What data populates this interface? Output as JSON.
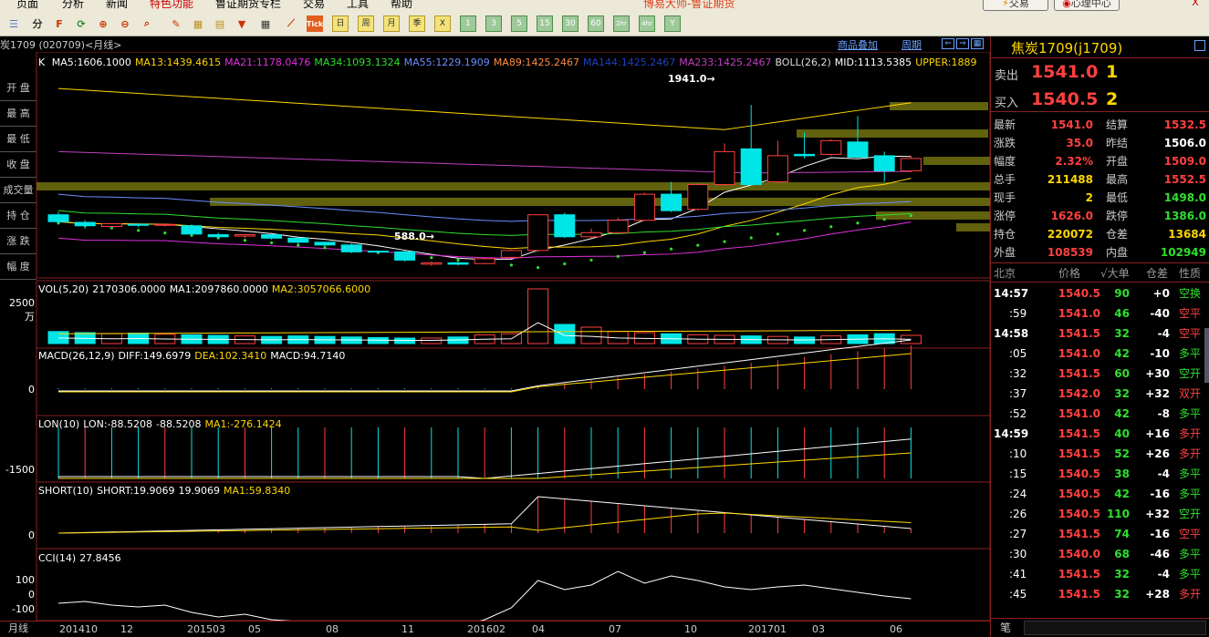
{
  "app": {
    "title": "博易大师-鲁证期货",
    "trade_button": "交易",
    "center_button": "心理中心",
    "close_button": "X"
  },
  "menu": [
    "页面",
    "分析",
    "新闻",
    "特色功能",
    "鲁证期货专栏",
    "交易",
    "工具",
    "帮助"
  ],
  "toolbar": {
    "period_buttons": [
      "日",
      "周",
      "月",
      "季",
      "X",
      "1",
      "3",
      "5",
      "15",
      "30",
      "60",
      "2hr",
      "4hr",
      "Y"
    ],
    "tick_label": "Tick"
  },
  "contract": {
    "header": "炭1709 (020709)<月线>",
    "overlay_link": "商品叠加",
    "period_link": "周期"
  },
  "left_labels": [
    "开 盘",
    "最 高",
    "最 低",
    "收 盘",
    "成交量",
    "持 仓",
    "涨 跌",
    "幅 度"
  ],
  "main_indicator": {
    "prefix": "K",
    "items": [
      {
        "text": "MA5:1606.1000",
        "color": "#ffffff"
      },
      {
        "text": "MA13:1439.4615",
        "color": "#ffd700"
      },
      {
        "text": "MA21:1178.0476",
        "color": "#e030e0"
      },
      {
        "text": "MA34:1093.1324",
        "color": "#2ee02e"
      },
      {
        "text": "MA55:1229.1909",
        "color": "#6a8cff"
      },
      {
        "text": "MA89:1425.2467",
        "color": "#ff8c40"
      },
      {
        "text": "MA144:1425.2467",
        "color": "#2040c0"
      },
      {
        "text": "MA233:1425.2467",
        "color": "#c040c0"
      },
      {
        "text": "BOLL(26,2)",
        "color": "#dddddd"
      },
      {
        "text": "MID:1113.5385",
        "color": "#ffffff"
      },
      {
        "text": "UPPER:1889",
        "color": "#ffd700"
      }
    ]
  },
  "main_annotations": {
    "high": "1941.0→",
    "low": "588.0→"
  },
  "vol": {
    "label": "VOL(5,20)",
    "value": "2170306.0000",
    "ma1": "MA1:2097860.0000",
    "ma2": "MA2:3057066.6000",
    "ylabel": "2500万"
  },
  "macd": {
    "label": "MACD(26,12,9)",
    "diff": "DIFF:149.6979",
    "dea": "DEA:102.3410",
    "macd": "MACD:94.7140",
    "ylabel": "0"
  },
  "lon": {
    "label": "LON(10)",
    "lon": "LON:-88.5208",
    "val": "-88.5208",
    "ma1": "MA1:-276.1424",
    "ylabel": "-1500"
  },
  "short": {
    "label": "SHORT(10)",
    "short": "SHORT:19.9069",
    "val": "19.9069",
    "ma1": "MA1:59.8340",
    "ylabel": "0"
  },
  "cci": {
    "label": "CCI(14)",
    "value": "27.8456",
    "y100": "100",
    "y0": "0",
    "yn100": "-100"
  },
  "xaxis": {
    "left_label": "月线",
    "ticks": [
      "201410",
      "12",
      "201503",
      "05",
      "08",
      "11",
      "201602",
      "04",
      "07",
      "10",
      "201701",
      "03",
      "06"
    ]
  },
  "quote": {
    "name": "焦炭1709(j1709)",
    "sell_label": "卖出",
    "sell_price": "1541.0",
    "sell_vol": "1",
    "buy_label": "买入",
    "buy_price": "1540.5",
    "buy_vol": "2",
    "rows": [
      {
        "l1": "最新",
        "v1": "1541.0",
        "c1": "up",
        "l2": "结算",
        "v2": "1532.5",
        "c2": "up"
      },
      {
        "l1": "涨跌",
        "v1": "35.0",
        "c1": "up",
        "l2": "昨结",
        "v2": "1506.0",
        "c2": "wh"
      },
      {
        "l1": "幅度",
        "v1": "2.32%",
        "c1": "up",
        "l2": "开盘",
        "v2": "1509.0",
        "c2": "up"
      },
      {
        "l1": "总手",
        "v1": "211488",
        "c1": "yl2",
        "l2": "最高",
        "v2": "1552.5",
        "c2": "up"
      },
      {
        "l1": "现手",
        "v1": "2",
        "c1": "yl2",
        "l2": "最低",
        "v2": "1498.0",
        "c2": "dn"
      },
      {
        "l1": "涨停",
        "v1": "1626.0",
        "c1": "up",
        "l2": "跌停",
        "v2": "1386.0",
        "c2": "dn"
      },
      {
        "l1": "持仓",
        "v1": "220072",
        "c1": "yl2",
        "l2": "仓差",
        "v2": "13684",
        "c2": "yl2"
      },
      {
        "l1": "外盘",
        "v1": "108539",
        "c1": "up",
        "l2": "内盘",
        "v2": "102949",
        "c2": "dn"
      }
    ],
    "trade_header": {
      "city": "北京",
      "price": "价格",
      "vol": "√大单",
      "diff": "仓差",
      "nature": "性质"
    },
    "trades": [
      {
        "t": "14:57",
        "p": "1540.5",
        "pc": "up",
        "v": "90",
        "d": "+0",
        "dc": "wh",
        "n": "空换",
        "nc": "dn"
      },
      {
        "t": ":59",
        "p": "1541.0",
        "pc": "up",
        "v": "46",
        "d": "-40",
        "dc": "wh",
        "n": "空平",
        "nc": "up"
      },
      {
        "t": "14:58",
        "p": "1541.5",
        "pc": "up",
        "v": "32",
        "d": "-4",
        "dc": "wh",
        "n": "空平",
        "nc": "up"
      },
      {
        "t": ":05",
        "p": "1541.0",
        "pc": "up",
        "v": "42",
        "d": "-10",
        "dc": "wh",
        "n": "多平",
        "nc": "dn"
      },
      {
        "t": ":32",
        "p": "1541.5",
        "pc": "up",
        "v": "60",
        "d": "+30",
        "dc": "wh",
        "n": "空开",
        "nc": "dn"
      },
      {
        "t": ":37",
        "p": "1542.0",
        "pc": "up",
        "v": "32",
        "d": "+32",
        "dc": "wh",
        "n": "双开",
        "nc": "up"
      },
      {
        "t": ":52",
        "p": "1541.0",
        "pc": "up",
        "v": "42",
        "d": "-8",
        "dc": "wh",
        "n": "多平",
        "nc": "dn"
      },
      {
        "t": "14:59",
        "p": "1541.5",
        "pc": "up",
        "v": "40",
        "d": "+16",
        "dc": "wh",
        "n": "多开",
        "nc": "up"
      },
      {
        "t": ":10",
        "p": "1541.5",
        "pc": "up",
        "v": "52",
        "d": "+26",
        "dc": "wh",
        "n": "多开",
        "nc": "up"
      },
      {
        "t": ":15",
        "p": "1540.5",
        "pc": "up",
        "v": "38",
        "d": "-4",
        "dc": "wh",
        "n": "多平",
        "nc": "dn"
      },
      {
        "t": ":24",
        "p": "1540.5",
        "pc": "up",
        "v": "42",
        "d": "-16",
        "dc": "wh",
        "n": "多平",
        "nc": "dn"
      },
      {
        "t": ":26",
        "p": "1540.5",
        "pc": "up",
        "v": "110",
        "d": "+32",
        "dc": "wh",
        "n": "空开",
        "nc": "dn"
      },
      {
        "t": ":27",
        "p": "1541.5",
        "pc": "up",
        "v": "74",
        "d": "-16",
        "dc": "wh",
        "n": "空平",
        "nc": "up"
      },
      {
        "t": ":30",
        "p": "1540.0",
        "pc": "up",
        "v": "68",
        "d": "-46",
        "dc": "wh",
        "n": "多平",
        "nc": "dn"
      },
      {
        "t": ":41",
        "p": "1541.5",
        "pc": "up",
        "v": "32",
        "d": "-4",
        "dc": "wh",
        "n": "多平",
        "nc": "dn"
      },
      {
        "t": ":45",
        "p": "1541.5",
        "pc": "up",
        "v": "32",
        "d": "+28",
        "dc": "wh",
        "n": "多开",
        "nc": "up"
      }
    ],
    "footer": "笔"
  },
  "colors": {
    "up": "#ff4040",
    "down": "#00e5e5",
    "frame": "#8a2020",
    "bg": "#000000"
  },
  "chart_data": {
    "type": "candlestick",
    "price_range": [
      500,
      2000
    ],
    "candles": [
      {
        "o": 960,
        "c": 910,
        "h": 980,
        "l": 890
      },
      {
        "o": 905,
        "c": 880,
        "h": 920,
        "l": 860
      },
      {
        "o": 875,
        "c": 895,
        "h": 900,
        "l": 860
      },
      {
        "o": 890,
        "c": 885,
        "h": 900,
        "l": 870
      },
      {
        "o": 885,
        "c": 890,
        "h": 895,
        "l": 875
      },
      {
        "o": 880,
        "c": 820,
        "h": 890,
        "l": 810
      },
      {
        "o": 815,
        "c": 800,
        "h": 830,
        "l": 790
      },
      {
        "o": 805,
        "c": 815,
        "h": 820,
        "l": 790
      },
      {
        "o": 815,
        "c": 790,
        "h": 830,
        "l": 780
      },
      {
        "o": 790,
        "c": 760,
        "h": 795,
        "l": 745
      },
      {
        "o": 760,
        "c": 740,
        "h": 765,
        "l": 730
      },
      {
        "o": 740,
        "c": 690,
        "h": 750,
        "l": 680
      },
      {
        "o": 695,
        "c": 690,
        "h": 700,
        "l": 680
      },
      {
        "o": 690,
        "c": 630,
        "h": 700,
        "l": 620
      },
      {
        "o": 600,
        "c": 610,
        "h": 620,
        "l": 588
      },
      {
        "o": 610,
        "c": 600,
        "h": 620,
        "l": 590
      },
      {
        "o": 605,
        "c": 640,
        "h": 650,
        "l": 600
      },
      {
        "o": 650,
        "c": 700,
        "h": 705,
        "l": 640
      },
      {
        "o": 700,
        "c": 960,
        "h": 965,
        "l": 690
      },
      {
        "o": 960,
        "c": 800,
        "h": 975,
        "l": 790
      },
      {
        "o": 800,
        "c": 830,
        "h": 860,
        "l": 790
      },
      {
        "o": 830,
        "c": 920,
        "h": 940,
        "l": 820
      },
      {
        "o": 920,
        "c": 1110,
        "h": 1120,
        "l": 915
      },
      {
        "o": 1110,
        "c": 990,
        "h": 1200,
        "l": 980
      },
      {
        "o": 1000,
        "c": 1180,
        "h": 1190,
        "l": 990
      },
      {
        "o": 1180,
        "c": 1420,
        "h": 1480,
        "l": 1170
      },
      {
        "o": 1440,
        "c": 1180,
        "h": 1760,
        "l": 1170
      },
      {
        "o": 1200,
        "c": 1390,
        "h": 1500,
        "l": 1190
      },
      {
        "o": 1400,
        "c": 1390,
        "h": 1560,
        "l": 1370
      },
      {
        "o": 1400,
        "c": 1500,
        "h": 1510,
        "l": 1390
      },
      {
        "o": 1490,
        "c": 1380,
        "h": 1680,
        "l": 1370
      },
      {
        "o": 1390,
        "c": 1280,
        "h": 1420,
        "l": 1200
      },
      {
        "o": 1280,
        "c": 1370,
        "h": 1390,
        "l": 1270
      }
    ],
    "vol": [
      0.22,
      0.2,
      0.18,
      0.19,
      0.17,
      0.16,
      0.15,
      0.14,
      0.13,
      0.14,
      0.13,
      0.12,
      0.11,
      0.1,
      0.1,
      0.12,
      0.16,
      0.18,
      1.0,
      0.35,
      0.3,
      0.22,
      0.2,
      0.18,
      0.16,
      0.15,
      0.14,
      0.13,
      0.12,
      0.14,
      0.16,
      0.18,
      0.15
    ],
    "ma_lines": [
      {
        "name": "MA5",
        "color": "#ffffff"
      },
      {
        "name": "MA13",
        "color": "#ffd700"
      },
      {
        "name": "MA21",
        "color": "#e030e0"
      },
      {
        "name": "MA34",
        "color": "#2ee02e"
      },
      {
        "name": "MA55",
        "color": "#6a8cff"
      },
      {
        "name": "BOLL-UPPER",
        "color": "#ffd700"
      }
    ]
  }
}
